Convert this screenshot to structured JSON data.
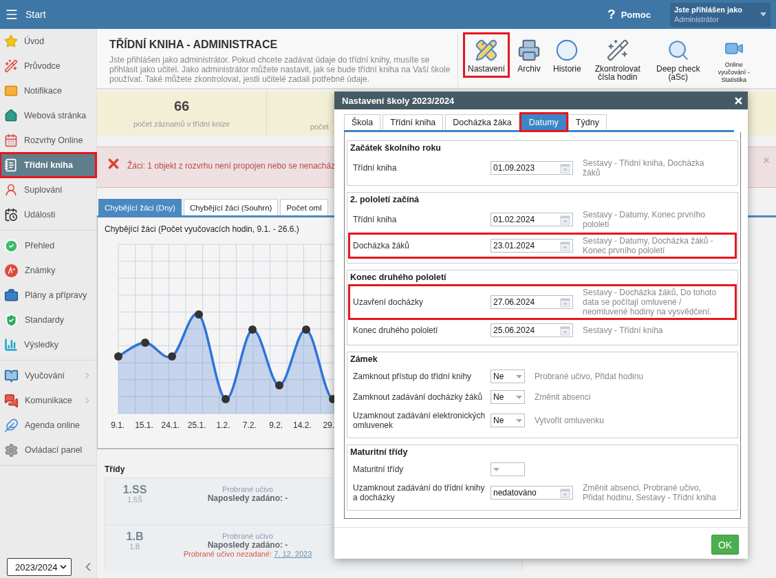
{
  "header": {
    "menu_label": "Start",
    "help_glyph": "?",
    "help_label": "Pomoc",
    "login": {
      "caption": "Jste přihlášen jako",
      "user": "Administrátor"
    }
  },
  "sidebar": {
    "groups": [
      [
        {
          "label": "Úvod",
          "selected": false,
          "highlighted": false,
          "has_submenu": false
        },
        {
          "label": "Průvodce",
          "selected": false,
          "highlighted": false,
          "has_submenu": false
        },
        {
          "label": "Notifikace",
          "selected": false,
          "highlighted": false,
          "has_submenu": false
        },
        {
          "label": "Webová stránka",
          "selected": false,
          "highlighted": false,
          "has_submenu": false
        },
        {
          "label": "Rozvrhy Online",
          "selected": false,
          "highlighted": false,
          "has_submenu": false
        },
        {
          "label": "Třídní kniha",
          "selected": true,
          "highlighted": true,
          "has_submenu": false
        },
        {
          "label": "Suplování",
          "selected": false,
          "highlighted": false,
          "has_submenu": false
        },
        {
          "label": "Události",
          "selected": false,
          "highlighted": false,
          "has_submenu": false
        }
      ],
      [
        {
          "label": "Přehled",
          "selected": false,
          "highlighted": false,
          "has_submenu": false
        },
        {
          "label": "Známky",
          "selected": false,
          "highlighted": false,
          "has_submenu": false
        },
        {
          "label": "Plány a přípravy",
          "selected": false,
          "highlighted": false,
          "has_submenu": false
        },
        {
          "label": "Standardy",
          "selected": false,
          "highlighted": false,
          "has_submenu": false
        },
        {
          "label": "Výsledky",
          "selected": false,
          "highlighted": false,
          "has_submenu": false
        }
      ],
      [
        {
          "label": "Vyučování",
          "selected": false,
          "highlighted": false,
          "has_submenu": true
        },
        {
          "label": "Komunikace",
          "selected": false,
          "highlighted": false,
          "has_submenu": true
        },
        {
          "label": "Agenda online",
          "selected": false,
          "highlighted": false,
          "has_submenu": false
        },
        {
          "label": "Ovládací panel",
          "selected": false,
          "highlighted": false,
          "has_submenu": false
        }
      ]
    ],
    "year": "2023/2024"
  },
  "page": {
    "title": "TŘÍDNÍ KNIHA - ADMINISTRACE",
    "description": "Jste přihlášen jako administrátor. Pokud chcete zadávat údaje do třídní knihy, musíte se přihlásit jako učitel. Jako administrátor můžete nastavit, jak se bude třídní kniha na Vaší škole používat. Také můžete zkontrolovat, jestli učitelé zadali potřebné údaje."
  },
  "toolbar": [
    {
      "label": "Nastavení",
      "kind": "normal",
      "highlighted": true
    },
    {
      "label": "Archiv",
      "kind": "normal",
      "highlighted": false
    },
    {
      "label": "Historie",
      "kind": "normal",
      "highlighted": false
    },
    {
      "label": "Zkontrolovat čísla hodin",
      "kind": "normal",
      "highlighted": false
    },
    {
      "label": "Deep check (aSc)",
      "kind": "normal",
      "highlighted": false
    },
    {
      "label": "Online vyučování - Statistika",
      "kind": "small",
      "highlighted": false
    }
  ],
  "stats": [
    {
      "value": "66",
      "label": "počet záznamů v třídní knize"
    },
    {
      "label": "počet"
    }
  ],
  "alert": {
    "text": "Žáci: 1 objekt z rozvrhu není propojen nebo se nenacház"
  },
  "tabs": [
    {
      "label": "Chybějící žáci (Dny)",
      "selected": true
    },
    {
      "label": "Chybějící žáci (Souhrn)",
      "selected": false
    },
    {
      "label": "Počet oml",
      "selected": false
    }
  ],
  "chart": {
    "title": "Chybějící žáci (Počet vyučovacích hodin, 9.1. - 26.6.)",
    "x_labels": [
      "9.1.",
      "15.1.",
      "24.1.",
      "25.1.",
      "1.2.",
      "7.2.",
      "9.2.",
      "14.2.",
      "29."
    ]
  },
  "classes": {
    "title": "Třídy",
    "rows": [
      {
        "code": "1.SS",
        "name": "1.SŠ",
        "topic": "Probrané učivo",
        "last": "Naposledy zadáno: -"
      },
      {
        "code": "1.B",
        "name": "1.B",
        "topic": "Probrané učivo",
        "last": "Naposledy zadáno: -",
        "missing_label": "Probrané učivo nezadané:",
        "missing_date": "7. 12. 2023"
      }
    ]
  },
  "dialog": {
    "title": "Nastavení školy 2023/2024",
    "tabs": [
      {
        "label": "Škola",
        "selected": false,
        "highlighted": false
      },
      {
        "label": "Třídní kniha",
        "selected": false,
        "highlighted": false
      },
      {
        "label": "Docházka žáka",
        "selected": false,
        "highlighted": false
      },
      {
        "label": "Datumy",
        "selected": true,
        "highlighted": true
      },
      {
        "label": "Týdny",
        "selected": false,
        "highlighted": false
      }
    ],
    "sections": [
      {
        "title": "Začátek školního roku",
        "rows": [
          {
            "kind": "date",
            "label": "Třídní kniha",
            "value": "01.09.2023",
            "description": "Sestavy - Třídní kniha, Docházka žáků",
            "highlighted": false
          }
        ]
      },
      {
        "title": "2. pololetí začíná",
        "rows": [
          {
            "kind": "date",
            "label": "Třídní kniha",
            "value": "01.02.2024",
            "description": "Sestavy - Datumy, Konec prvního pololetí",
            "highlighted": false
          },
          {
            "kind": "date",
            "label": "Docházka žáků",
            "value": "23.01.2024",
            "description": "Sestavy - Datumy, Docházka žáků - Konec prvního pololetí",
            "highlighted": true
          }
        ]
      },
      {
        "title": "Konec druhého pololetí",
        "rows": [
          {
            "kind": "date",
            "label": "Uzavření docházky",
            "value": "27.06.2024",
            "description": "Sestavy - Docházka žáků, Do tohoto data se počítají omluvené / neomluvené hodiny na vysvědčení.",
            "highlighted": true
          },
          {
            "kind": "date",
            "label": "Konec druhého pololetí",
            "value": "25.06.2024",
            "description": "Sestavy - Třídní kniha",
            "highlighted": false
          }
        ]
      },
      {
        "title": "Zámek",
        "rows": [
          {
            "kind": "select",
            "label": "Zamknout přístup do třídní knihy",
            "value": "Ne",
            "description": "Probrané učivo, Přidat hodinu",
            "highlighted": false
          },
          {
            "kind": "select",
            "label": "Zamknout zadávání docházky žáků",
            "value": "Ne",
            "description": "Změnit absenci",
            "highlighted": false
          },
          {
            "kind": "select",
            "label": "Uzamknout zadávání elektronických omluvenek",
            "value": "Ne",
            "description": "Vytvořit omluvenku",
            "highlighted": false
          }
        ]
      },
      {
        "title": "Maturitní třídy",
        "rows": [
          {
            "kind": "select",
            "label": "Maturitní třídy",
            "highlighted": false
          },
          {
            "kind": "date",
            "label": "Uzamknout zadávání do třídní knihy a docházky",
            "value": "nedatováno",
            "description": "Změnit absenci, Probrané učivo, Přidat hodinu, Sestavy - Třídní kniha",
            "highlighted": false
          }
        ]
      }
    ],
    "ok": "OK"
  }
}
